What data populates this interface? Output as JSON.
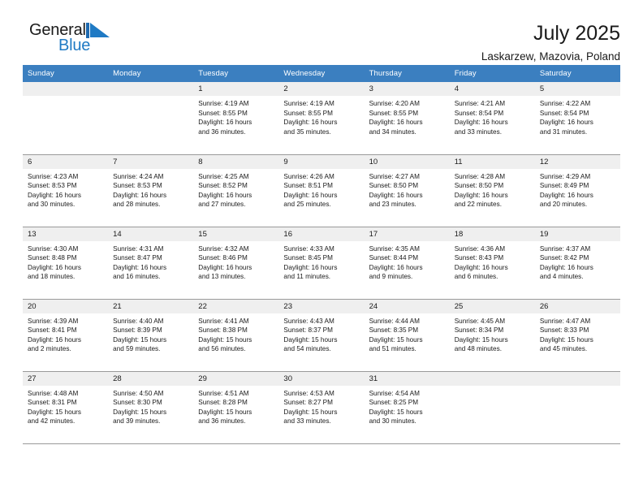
{
  "logo": {
    "name_part1": "General",
    "name_part2": "Blue",
    "mark": "triangle-logo-mark",
    "accent_color": "#1f7ac4"
  },
  "header": {
    "title": "July 2025",
    "location": "Laskarzew, Mazovia, Poland",
    "band_color": "#3b7fc0"
  },
  "calendar": {
    "weekday_headers": [
      "Sunday",
      "Monday",
      "Tuesday",
      "Wednesday",
      "Thursday",
      "Friday",
      "Saturday"
    ],
    "daynum_band_color": "#efefef",
    "labels": {
      "sunrise": "Sunrise:",
      "sunset": "Sunset:",
      "daylight": "Daylight:"
    },
    "weeks": [
      [
        {
          "day": "",
          "empty": true
        },
        {
          "day": "",
          "empty": true
        },
        {
          "day": "1",
          "sunrise": "Sunrise: 4:19 AM",
          "sunset": "Sunset: 8:55 PM",
          "daylight1": "Daylight: 16 hours",
          "daylight2": "and 36 minutes."
        },
        {
          "day": "2",
          "sunrise": "Sunrise: 4:19 AM",
          "sunset": "Sunset: 8:55 PM",
          "daylight1": "Daylight: 16 hours",
          "daylight2": "and 35 minutes."
        },
        {
          "day": "3",
          "sunrise": "Sunrise: 4:20 AM",
          "sunset": "Sunset: 8:55 PM",
          "daylight1": "Daylight: 16 hours",
          "daylight2": "and 34 minutes."
        },
        {
          "day": "4",
          "sunrise": "Sunrise: 4:21 AM",
          "sunset": "Sunset: 8:54 PM",
          "daylight1": "Daylight: 16 hours",
          "daylight2": "and 33 minutes."
        },
        {
          "day": "5",
          "sunrise": "Sunrise: 4:22 AM",
          "sunset": "Sunset: 8:54 PM",
          "daylight1": "Daylight: 16 hours",
          "daylight2": "and 31 minutes."
        }
      ],
      [
        {
          "day": "6",
          "sunrise": "Sunrise: 4:23 AM",
          "sunset": "Sunset: 8:53 PM",
          "daylight1": "Daylight: 16 hours",
          "daylight2": "and 30 minutes."
        },
        {
          "day": "7",
          "sunrise": "Sunrise: 4:24 AM",
          "sunset": "Sunset: 8:53 PM",
          "daylight1": "Daylight: 16 hours",
          "daylight2": "and 28 minutes."
        },
        {
          "day": "8",
          "sunrise": "Sunrise: 4:25 AM",
          "sunset": "Sunset: 8:52 PM",
          "daylight1": "Daylight: 16 hours",
          "daylight2": "and 27 minutes."
        },
        {
          "day": "9",
          "sunrise": "Sunrise: 4:26 AM",
          "sunset": "Sunset: 8:51 PM",
          "daylight1": "Daylight: 16 hours",
          "daylight2": "and 25 minutes."
        },
        {
          "day": "10",
          "sunrise": "Sunrise: 4:27 AM",
          "sunset": "Sunset: 8:50 PM",
          "daylight1": "Daylight: 16 hours",
          "daylight2": "and 23 minutes."
        },
        {
          "day": "11",
          "sunrise": "Sunrise: 4:28 AM",
          "sunset": "Sunset: 8:50 PM",
          "daylight1": "Daylight: 16 hours",
          "daylight2": "and 22 minutes."
        },
        {
          "day": "12",
          "sunrise": "Sunrise: 4:29 AM",
          "sunset": "Sunset: 8:49 PM",
          "daylight1": "Daylight: 16 hours",
          "daylight2": "and 20 minutes."
        }
      ],
      [
        {
          "day": "13",
          "sunrise": "Sunrise: 4:30 AM",
          "sunset": "Sunset: 8:48 PM",
          "daylight1": "Daylight: 16 hours",
          "daylight2": "and 18 minutes."
        },
        {
          "day": "14",
          "sunrise": "Sunrise: 4:31 AM",
          "sunset": "Sunset: 8:47 PM",
          "daylight1": "Daylight: 16 hours",
          "daylight2": "and 16 minutes."
        },
        {
          "day": "15",
          "sunrise": "Sunrise: 4:32 AM",
          "sunset": "Sunset: 8:46 PM",
          "daylight1": "Daylight: 16 hours",
          "daylight2": "and 13 minutes."
        },
        {
          "day": "16",
          "sunrise": "Sunrise: 4:33 AM",
          "sunset": "Sunset: 8:45 PM",
          "daylight1": "Daylight: 16 hours",
          "daylight2": "and 11 minutes."
        },
        {
          "day": "17",
          "sunrise": "Sunrise: 4:35 AM",
          "sunset": "Sunset: 8:44 PM",
          "daylight1": "Daylight: 16 hours",
          "daylight2": "and 9 minutes."
        },
        {
          "day": "18",
          "sunrise": "Sunrise: 4:36 AM",
          "sunset": "Sunset: 8:43 PM",
          "daylight1": "Daylight: 16 hours",
          "daylight2": "and 6 minutes."
        },
        {
          "day": "19",
          "sunrise": "Sunrise: 4:37 AM",
          "sunset": "Sunset: 8:42 PM",
          "daylight1": "Daylight: 16 hours",
          "daylight2": "and 4 minutes."
        }
      ],
      [
        {
          "day": "20",
          "sunrise": "Sunrise: 4:39 AM",
          "sunset": "Sunset: 8:41 PM",
          "daylight1": "Daylight: 16 hours",
          "daylight2": "and 2 minutes."
        },
        {
          "day": "21",
          "sunrise": "Sunrise: 4:40 AM",
          "sunset": "Sunset: 8:39 PM",
          "daylight1": "Daylight: 15 hours",
          "daylight2": "and 59 minutes."
        },
        {
          "day": "22",
          "sunrise": "Sunrise: 4:41 AM",
          "sunset": "Sunset: 8:38 PM",
          "daylight1": "Daylight: 15 hours",
          "daylight2": "and 56 minutes."
        },
        {
          "day": "23",
          "sunrise": "Sunrise: 4:43 AM",
          "sunset": "Sunset: 8:37 PM",
          "daylight1": "Daylight: 15 hours",
          "daylight2": "and 54 minutes."
        },
        {
          "day": "24",
          "sunrise": "Sunrise: 4:44 AM",
          "sunset": "Sunset: 8:35 PM",
          "daylight1": "Daylight: 15 hours",
          "daylight2": "and 51 minutes."
        },
        {
          "day": "25",
          "sunrise": "Sunrise: 4:45 AM",
          "sunset": "Sunset: 8:34 PM",
          "daylight1": "Daylight: 15 hours",
          "daylight2": "and 48 minutes."
        },
        {
          "day": "26",
          "sunrise": "Sunrise: 4:47 AM",
          "sunset": "Sunset: 8:33 PM",
          "daylight1": "Daylight: 15 hours",
          "daylight2": "and 45 minutes."
        }
      ],
      [
        {
          "day": "27",
          "sunrise": "Sunrise: 4:48 AM",
          "sunset": "Sunset: 8:31 PM",
          "daylight1": "Daylight: 15 hours",
          "daylight2": "and 42 minutes."
        },
        {
          "day": "28",
          "sunrise": "Sunrise: 4:50 AM",
          "sunset": "Sunset: 8:30 PM",
          "daylight1": "Daylight: 15 hours",
          "daylight2": "and 39 minutes."
        },
        {
          "day": "29",
          "sunrise": "Sunrise: 4:51 AM",
          "sunset": "Sunset: 8:28 PM",
          "daylight1": "Daylight: 15 hours",
          "daylight2": "and 36 minutes."
        },
        {
          "day": "30",
          "sunrise": "Sunrise: 4:53 AM",
          "sunset": "Sunset: 8:27 PM",
          "daylight1": "Daylight: 15 hours",
          "daylight2": "and 33 minutes."
        },
        {
          "day": "31",
          "sunrise": "Sunrise: 4:54 AM",
          "sunset": "Sunset: 8:25 PM",
          "daylight1": "Daylight: 15 hours",
          "daylight2": "and 30 minutes."
        },
        {
          "day": "",
          "empty": true
        },
        {
          "day": "",
          "empty": true
        }
      ]
    ]
  }
}
